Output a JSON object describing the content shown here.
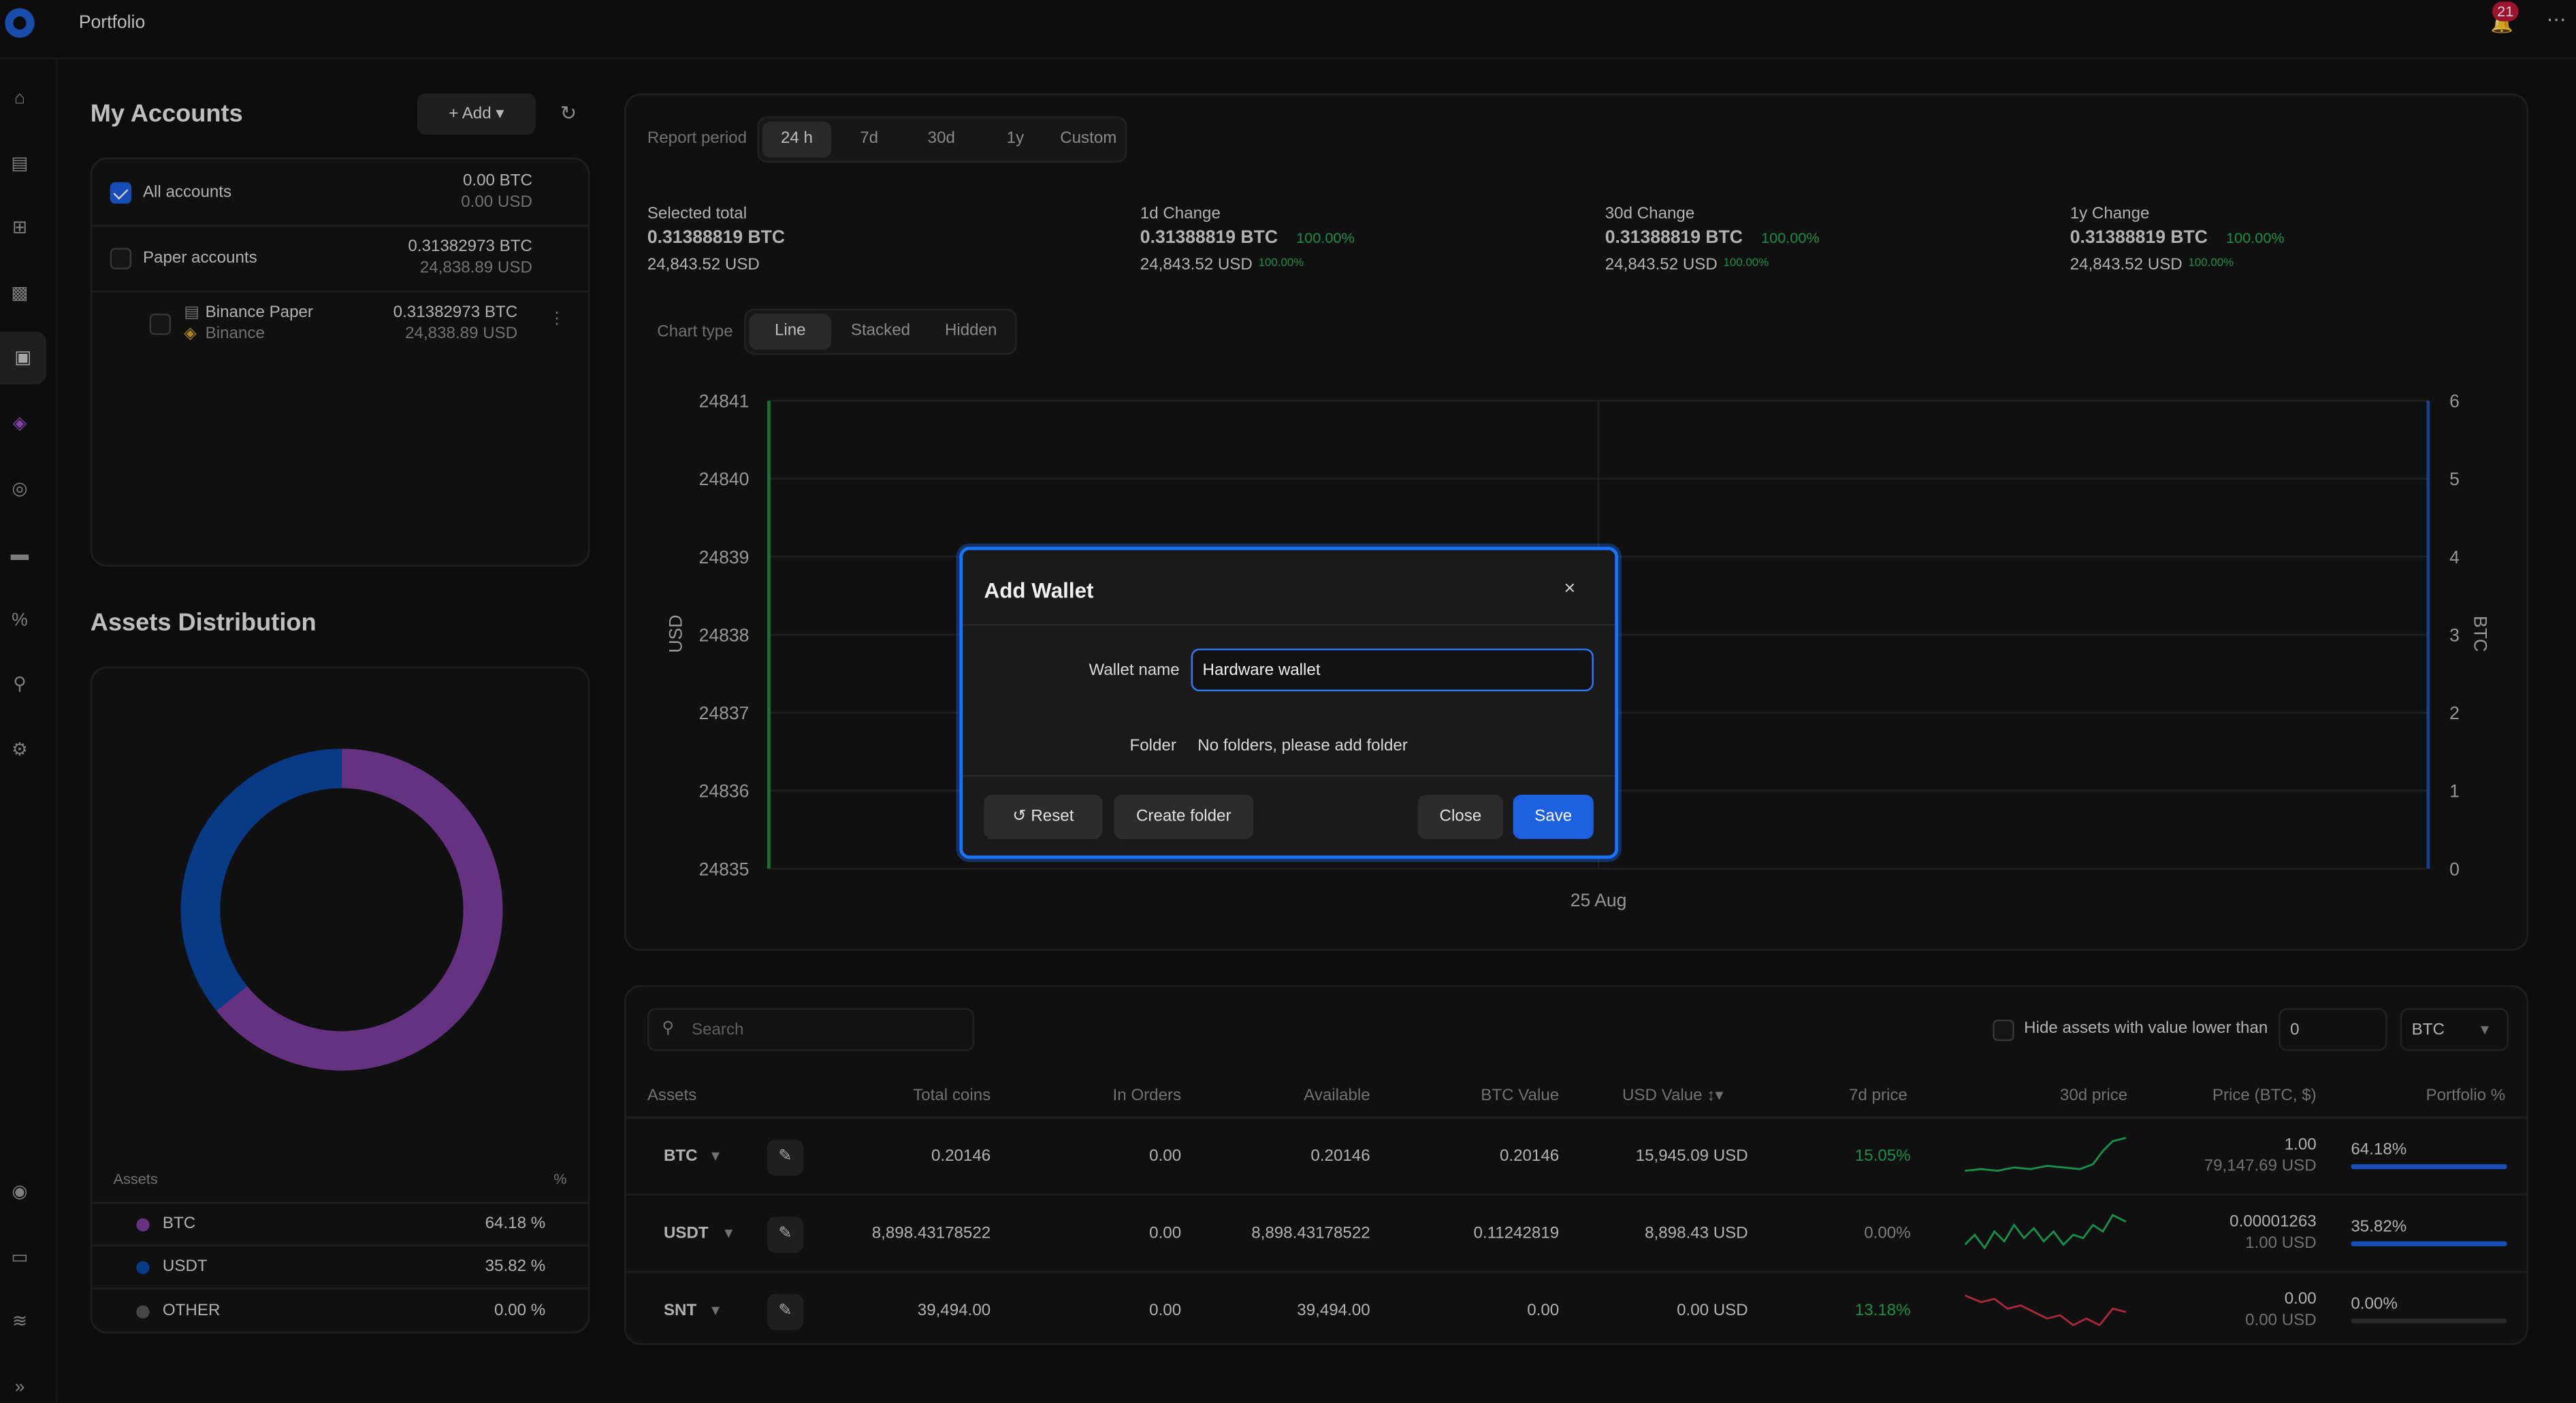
{
  "app": {
    "title": "Portfolio",
    "notification_count": "21"
  },
  "accounts": {
    "title": "My Accounts",
    "add_label": "Add",
    "rows": [
      {
        "label": "All accounts",
        "btc": "0.00 BTC",
        "usd": "0.00 USD",
        "checked": true
      },
      {
        "label": "Paper accounts",
        "btc": "0.31382973 BTC",
        "usd": "24,838.89 USD",
        "checked": false
      },
      {
        "label": "Binance Paper",
        "sub": "Binance",
        "btc": "0.31382973 BTC",
        "usd": "24,838.89 USD",
        "checked": false
      }
    ]
  },
  "distribution": {
    "title": "Assets Distribution",
    "col_assets": "Assets",
    "col_pct": "%",
    "rows": [
      {
        "name": "BTC",
        "pct": "64.18 %",
        "color": "#7b3d9e"
      },
      {
        "name": "USDT",
        "pct": "35.82 %",
        "color": "#0a47a3"
      },
      {
        "name": "OTHER",
        "pct": "0.00 %",
        "color": "#555555"
      }
    ]
  },
  "report": {
    "period_label": "Report period",
    "periods": [
      "24 h",
      "7d",
      "30d",
      "1y",
      "Custom"
    ],
    "selected_period": "24 h",
    "stats": [
      {
        "label": "Selected total",
        "btc": "0.31388819 BTC",
        "usd": "24,843.52 USD",
        "pct": "",
        "pct_small": ""
      },
      {
        "label": "1d Change",
        "btc": "0.31388819 BTC",
        "usd": "24,843.52 USD",
        "pct": "100.00%",
        "pct_small": "100.00%"
      },
      {
        "label": "30d Change",
        "btc": "0.31388819 BTC",
        "usd": "24,843.52 USD",
        "pct": "100.00%",
        "pct_small": "100.00%"
      },
      {
        "label": "1y Change",
        "btc": "0.31388819 BTC",
        "usd": "24,843.52 USD",
        "pct": "100.00%",
        "pct_small": "100.00%"
      }
    ],
    "chart_type_label": "Chart type",
    "chart_types": [
      "Line",
      "Stacked",
      "Hidden"
    ],
    "selected_chart_type": "Line"
  },
  "chart_data": {
    "type": "line",
    "xlabel": "",
    "x_ticks": [
      "25 Aug"
    ],
    "ylabel_left": "USD",
    "ylabel_right": "BTC",
    "y_left_ticks": [
      "24841",
      "24840",
      "24839",
      "24838",
      "24837",
      "24836",
      "24835"
    ],
    "y_right_ticks": [
      "6",
      "5",
      "4",
      "3",
      "2",
      "1",
      "0"
    ],
    "ylim_left": [
      24835,
      24841
    ],
    "ylim_right": [
      0,
      6
    ],
    "grid": true,
    "series": []
  },
  "dialog": {
    "title": "Add Wallet",
    "wallet_name_label": "Wallet name",
    "wallet_name_value": "Hardware wallet",
    "folder_label": "Folder",
    "folder_value": "No folders, please add folder",
    "reset_label": "Reset",
    "create_folder_label": "Create folder",
    "close_label": "Close",
    "save_label": "Save",
    "accent": "#1a73ff"
  },
  "assets_table": {
    "search_placeholder": "Search",
    "hide_label": "Hide assets with value lower than",
    "hide_value": "0",
    "currency": "BTC",
    "columns": [
      "Assets",
      "Total coins",
      "In Orders",
      "Available",
      "BTC Value",
      "USD Value",
      "7d price",
      "30d price",
      "Price (BTC, $)",
      "Portfolio %"
    ],
    "rows": [
      {
        "asset": "BTC",
        "total": "0.20146",
        "orders": "0.00",
        "available": "0.20146",
        "btc_value": "0.20146",
        "usd_value": "15,945.09 USD",
        "change7d": "15.05%",
        "price_btc": "1.00",
        "price_usd": "79,147.69 USD",
        "portfolio": "64.18%",
        "portfolio_frac": 1.0,
        "positive": true
      },
      {
        "asset": "USDT",
        "total": "8,898.43178522",
        "orders": "0.00",
        "available": "8,898.43178522",
        "btc_value": "0.11242819",
        "usd_value": "8,898.43 USD",
        "change7d": "0.00%",
        "price_btc": "0.00001263",
        "price_usd": "1.00 USD",
        "portfolio": "35.82%",
        "portfolio_frac": 1.0,
        "positive": true
      },
      {
        "asset": "SNT",
        "total": "39,494.00",
        "orders": "0.00",
        "available": "39,494.00",
        "btc_value": "0.00",
        "usd_value": "0.00 USD",
        "change7d": "13.18%",
        "price_btc": "0.00",
        "price_usd": "0.00 USD",
        "portfolio": "0.00%",
        "portfolio_frac": 0.0,
        "positive": false
      }
    ]
  }
}
